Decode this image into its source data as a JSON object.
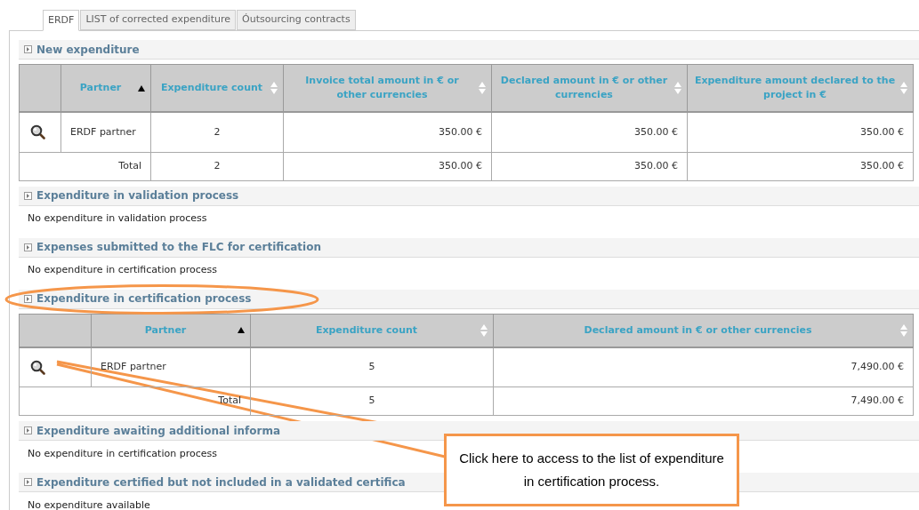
{
  "tabs": [
    {
      "label": "ERDF",
      "selected": true
    },
    {
      "label": "LIST of corrected expenditure",
      "selected": false
    },
    {
      "label": "Óutsourcing contracts",
      "selected": false
    }
  ],
  "sections": [
    {
      "title": "New expenditure",
      "kind": "table",
      "table": {
        "columns": [
          {
            "label": "Partner",
            "sorted": true
          },
          {
            "label": "Expenditure count",
            "sorted": false
          },
          {
            "label": "Invoice total amount in € or other currencies",
            "sorted": false
          },
          {
            "label": "Declared amount in € or other currencies",
            "sorted": false
          },
          {
            "label": "Expenditure amount declared to the project in €",
            "sorted": false
          }
        ],
        "rows": [
          {
            "kind": "item",
            "cells": [
              "ERDF partner",
              "2",
              "350.00 €",
              "350.00 €",
              "350.00 €"
            ]
          },
          {
            "kind": "total",
            "cells": [
              "Total",
              "2",
              "350.00 €",
              "350.00 €",
              "350.00 €"
            ]
          }
        ]
      }
    },
    {
      "title": "Expenditure in validation process",
      "kind": "message",
      "message": "No expenditure in validation process"
    },
    {
      "title": "Expenses submitted to the FLC for certification",
      "kind": "message",
      "message": "No expenditure in certification process"
    },
    {
      "title": "Expenditure in certification process",
      "kind": "table",
      "highlighted": true,
      "table": {
        "columns": [
          {
            "label": "Partner",
            "sorted": true
          },
          {
            "label": "Expenditure count",
            "sorted": false
          },
          {
            "label": "Declared amount in € or other currencies",
            "sorted": false
          }
        ],
        "rows": [
          {
            "kind": "item",
            "cells": [
              "ERDF partner",
              "5",
              "7,490.00 €"
            ]
          },
          {
            "kind": "total",
            "cells": [
              "Total",
              "5",
              "7,490.00 €"
            ]
          }
        ]
      }
    },
    {
      "title": "Expenditure awaiting additional informa",
      "kind": "message",
      "message": "No expenditure in certification process"
    },
    {
      "title": "Expenditure certified but not included in a validated certifica",
      "kind": "message",
      "message": "No expenditure available"
    }
  ],
  "callout": {
    "text": "Click here to access to the list of expenditure in certification process."
  }
}
